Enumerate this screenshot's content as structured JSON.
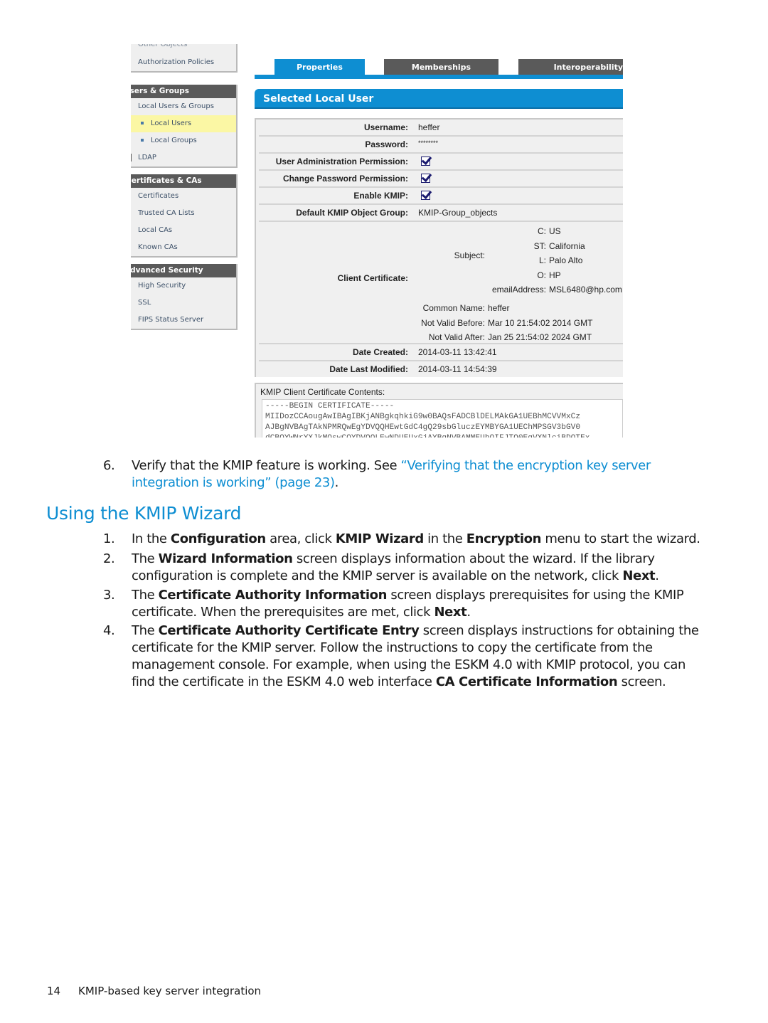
{
  "screenshot": {
    "sidebar": {
      "top_cut_item": "Other Objects",
      "groups": [
        {
          "header": null,
          "items": [
            {
              "label": "Authorization Policies",
              "type": "item"
            }
          ]
        },
        {
          "header": "Users & Groups",
          "items": [
            {
              "label": "Local Users & Groups",
              "type": "item"
            },
            {
              "label": "Local Users",
              "type": "sub",
              "active": true
            },
            {
              "label": "Local Groups",
              "type": "sub"
            },
            {
              "label": "LDAP",
              "type": "item"
            }
          ]
        },
        {
          "header": "Certificates & CAs",
          "items": [
            {
              "label": "Certificates",
              "type": "item"
            },
            {
              "label": "Trusted CA Lists",
              "type": "item"
            },
            {
              "label": "Local CAs",
              "type": "item"
            },
            {
              "label": "Known CAs",
              "type": "item"
            }
          ]
        },
        {
          "header": "Advanced Security",
          "items": [
            {
              "label": "High Security",
              "type": "item"
            },
            {
              "label": "SSL",
              "type": "item"
            },
            {
              "label": "FIPS Status Server",
              "type": "item"
            }
          ]
        }
      ]
    },
    "tabs": [
      {
        "label": "Properties",
        "active": true
      },
      {
        "label": "Memberships",
        "active": false
      },
      {
        "label": "Interoperability",
        "active": false
      }
    ],
    "panel_title": "Selected Local User",
    "properties": {
      "username": {
        "label": "Username:",
        "value": "heffer"
      },
      "password": {
        "label": "Password:",
        "value": "********"
      },
      "user_admin": {
        "label": "User Administration Permission:",
        "checked": true
      },
      "change_password": {
        "label": "Change Password Permission:",
        "checked": true
      },
      "enable_kmip": {
        "label": "Enable KMIP:",
        "checked": true
      },
      "default_group": {
        "label": "Default KMIP Object Group:",
        "value": "KMIP-Group_objects"
      },
      "client_certificate": {
        "label": "Client Certificate:",
        "subject_label": "Subject:",
        "subject": [
          {
            "k": "C:",
            "v": "US"
          },
          {
            "k": "ST:",
            "v": "California"
          },
          {
            "k": "L:",
            "v": "Palo Alto"
          },
          {
            "k": "O:",
            "v": "HP"
          },
          {
            "k": "emailAddress:",
            "v": "MSL6480@hp.com"
          }
        ],
        "details": [
          {
            "k": "Common Name:",
            "v": "heffer"
          },
          {
            "k": "Not Valid Before:",
            "v": "Mar 10 21:54:02 2014 GMT"
          },
          {
            "k": "Not Valid After:",
            "v": "Jan 25 21:54:02 2024 GMT"
          }
        ]
      },
      "date_created": {
        "label": "Date Created:",
        "value": "2014-03-11 13:42:41"
      },
      "date_modified": {
        "label": "Date Last Modified:",
        "value": "2014-03-11 14:54:39"
      }
    },
    "cert_contents": {
      "label": "KMIP Client Certificate Contents:",
      "text": "-----BEGIN CERTIFICATE-----\nMIIDozCCAougAwIBAgIBKjANBgkqhkiG9w0BAQsFADCBlDELMAkGA1UEBhMCVVMxCz\nAJBgNVBAgTAkNPMRQwEgYDVQQHEwtGdC4gQ29sbGluczEYMBYGA1UEChMPSGV3bGV0\ndCBQYWNrYXJkMQswCQYDVQQLEwNDUEUxGjAYBgNVBAMMEUhQIFJTQ0EgVXNlciBDQTEx"
    }
  },
  "document": {
    "step6": {
      "num": "6.",
      "text": "Verify that the KMIP feature is working. See ",
      "link": "“Verifying that the encryption key server integration is working” (page 23)",
      "end": "."
    },
    "heading": "Using the KMIP Wizard",
    "steps": [
      {
        "num": "1.",
        "parts": [
          {
            "t": "In the "
          },
          {
            "b": "Configuration"
          },
          {
            "t": " area, click "
          },
          {
            "b": "KMIP Wizard"
          },
          {
            "t": " in the "
          },
          {
            "b": "Encryption"
          },
          {
            "t": " menu to start the wizard."
          }
        ]
      },
      {
        "num": "2.",
        "parts": [
          {
            "t": "The "
          },
          {
            "b": "Wizard Information"
          },
          {
            "t": " screen displays information about the wizard. If the library configuration is complete and the KMIP server is available on the network, click "
          },
          {
            "b": "Next"
          },
          {
            "t": "."
          }
        ]
      },
      {
        "num": "3.",
        "parts": [
          {
            "t": "The "
          },
          {
            "b": "Certificate Authority Information"
          },
          {
            "t": " screen displays prerequisites for using the KMIP certificate. When the prerequisites are met, click "
          },
          {
            "b": "Next"
          },
          {
            "t": "."
          }
        ]
      },
      {
        "num": "4.",
        "parts": [
          {
            "t": "The "
          },
          {
            "b": "Certificate Authority Certificate Entry"
          },
          {
            "t": " screen displays instructions for obtaining the certificate for the KMIP server. Follow the instructions to copy the certificate from the management console. For example, when using the ESKM 4.0 with KMIP protocol, you can find the certificate in the ESKM 4.0 web interface "
          },
          {
            "b": "CA Certificate Information"
          },
          {
            "t": " screen."
          }
        ]
      }
    ],
    "footer": {
      "page": "14",
      "title": "KMIP-based key server integration"
    }
  },
  "colors": {
    "accent": "#0e8ed2",
    "tab_inactive": "#5a5a5a",
    "active_item": "#fbf7a4"
  }
}
